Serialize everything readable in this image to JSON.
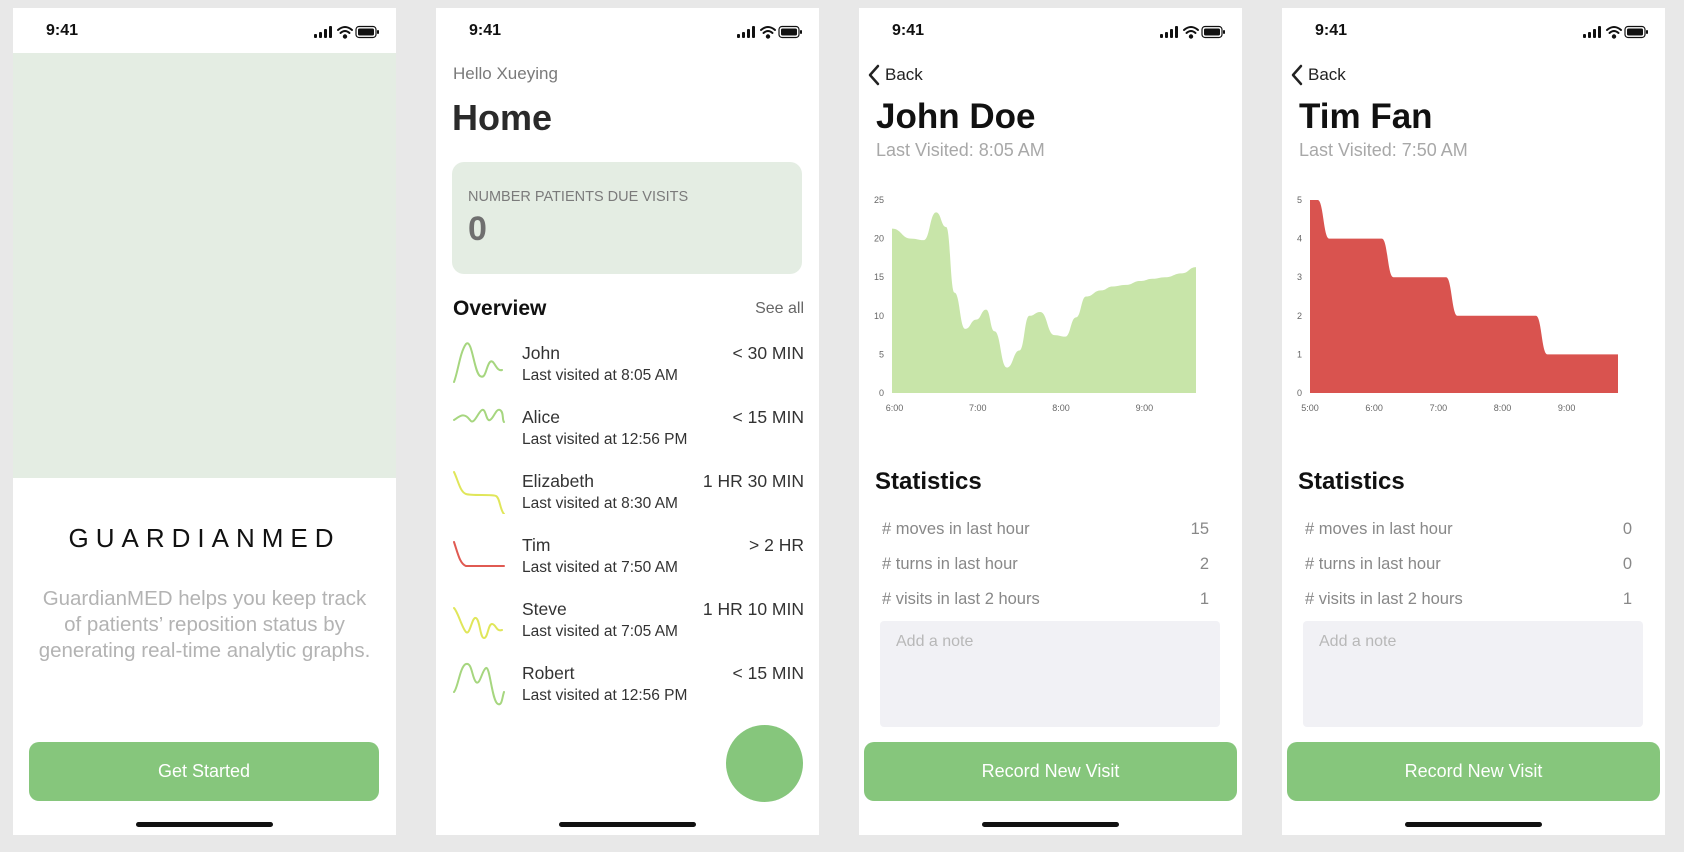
{
  "status_time": "9:41",
  "welcome": {
    "brand": "GUARDIANMED",
    "tagline": "GuardianMED helps you keep track of patients’ reposition status by generating real-time analytic graphs.",
    "cta": "Get Started"
  },
  "home": {
    "greeting": "Hello Xueying",
    "title": "Home",
    "due_card": {
      "label": "NUMBER PATIENTS DUE VISITS",
      "value": "0"
    },
    "overview_title": "Overview",
    "see_all": "See all",
    "patients": [
      {
        "name": "John",
        "last_visited": "Last visited at 8:05 AM",
        "due": "< 30 MIN",
        "status_color": "#a6d67f"
      },
      {
        "name": "Alice",
        "last_visited": "Last visited at 12:56 PM",
        "due": "< 15 MIN",
        "status_color": "#a6d67f"
      },
      {
        "name": "Elizabeth",
        "last_visited": "Last visited at 8:30 AM",
        "due": "1 HR 30 MIN",
        "status_color": "#e0e65a"
      },
      {
        "name": "Tim",
        "last_visited": "Last visited at 7:50 AM",
        "due": "> 2 HR",
        "status_color": "#e05a52"
      },
      {
        "name": "Steve",
        "last_visited": "Last visited at 7:05 AM",
        "due": "1 HR 10 MIN",
        "status_color": "#e0e65a"
      },
      {
        "name": "Robert",
        "last_visited": "Last visited at 12:56 PM",
        "due": "< 15 MIN",
        "status_color": "#a6d67f"
      }
    ]
  },
  "detail_common": {
    "back_label": "Back",
    "statistics_title": "Statistics",
    "note_placeholder": "Add a note",
    "record_button": "Record New Visit"
  },
  "john": {
    "name": "John Doe",
    "last_visited": "Last Visited: 8:05 AM",
    "stats": [
      {
        "label": "# moves in last hour",
        "value": "15"
      },
      {
        "label": "# turns in last hour",
        "value": "2"
      },
      {
        "label": "# visits in last 2 hours",
        "value": "1"
      }
    ]
  },
  "tim": {
    "name": "Tim Fan",
    "last_visited": "Last Visited: 7:50 AM",
    "stats": [
      {
        "label": "# moves in last hour",
        "value": "0"
      },
      {
        "label": "# turns in last hour",
        "value": "0"
      },
      {
        "label": "# visits in last 2 hours",
        "value": "1"
      }
    ]
  },
  "chart_data": [
    {
      "type": "area",
      "color": "#c8e5a9",
      "x_ticks": [
        "6:00",
        "7:00",
        "8:00",
        "9:00"
      ],
      "x_tick_positions": [
        6.0,
        7.0,
        8.0,
        9.0
      ],
      "y_ticks": [
        "0",
        "5",
        "10",
        "15",
        "20",
        "25"
      ],
      "ylim": [
        0,
        25
      ],
      "xlim": [
        5.97,
        9.62
      ],
      "x": [
        5.97,
        6.2,
        6.35,
        6.5,
        6.62,
        6.72,
        6.85,
        6.98,
        7.1,
        7.2,
        7.35,
        7.5,
        7.62,
        7.75,
        7.92,
        8.05,
        8.18,
        8.3,
        8.48,
        8.62,
        8.78,
        8.95,
        9.1,
        9.25,
        9.45,
        9.62
      ],
      "y": [
        21.3,
        20.0,
        19.8,
        23.4,
        21.5,
        13.0,
        8.3,
        9.5,
        10.8,
        8.0,
        3.3,
        5.5,
        10.0,
        10.5,
        7.5,
        7.3,
        9.8,
        12.5,
        13.3,
        13.8,
        14.0,
        14.5,
        14.8,
        15.0,
        15.5,
        16.3
      ]
    },
    {
      "type": "area",
      "color": "#d9534f",
      "x_ticks": [
        "5:00",
        "6:00",
        "7:00",
        "8:00",
        "9:00"
      ],
      "x_tick_positions": [
        5.0,
        6.0,
        7.0,
        8.0,
        9.0
      ],
      "y_ticks": [
        "0",
        "1",
        "2",
        "3",
        "4",
        "5"
      ],
      "ylim": [
        0,
        5
      ],
      "xlim": [
        5.0,
        9.8
      ],
      "steps": [
        [
          5.0,
          5.0
        ],
        [
          5.3,
          4.0
        ],
        [
          6.3,
          3.0
        ],
        [
          7.3,
          2.0
        ],
        [
          8.7,
          1.0
        ],
        [
          9.8,
          1.0
        ]
      ]
    }
  ]
}
